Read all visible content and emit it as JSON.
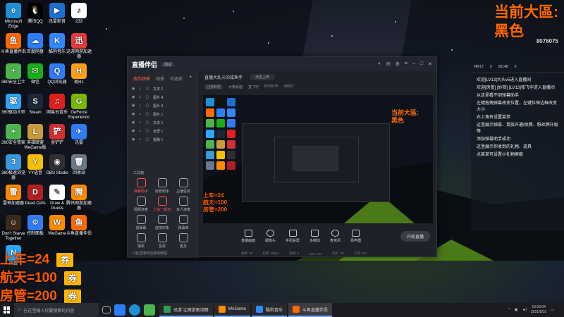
{
  "desktop_icons": [
    {
      "label": "Microsoft Edge",
      "color": "#1f8fd6",
      "glyph": "e"
    },
    {
      "label": "腾讯QQ",
      "color": "#000000",
      "glyph": "🐧"
    },
    {
      "label": "迅雷影音",
      "color": "#1e6fd0",
      "glyph": "▶"
    },
    {
      "label": "233",
      "color": "#ffffff",
      "glyph": "♪"
    },
    {
      "label": "斗鱼直播伴侣",
      "color": "#ff6a00",
      "glyph": "鱼"
    },
    {
      "label": "百度网盘",
      "color": "#2f7df6",
      "glyph": "☁"
    },
    {
      "label": "酷狗音乐",
      "color": "#2f88ff",
      "glyph": "K"
    },
    {
      "label": "迅游网游加速器",
      "color": "#e23b3b",
      "glyph": "迅"
    },
    {
      "label": "360安全卫士",
      "color": "#4bb44b",
      "glyph": "+"
    },
    {
      "label": "微信",
      "color": "#1aad19",
      "glyph": "✉"
    },
    {
      "label": "QQ浏览器",
      "color": "#2f7df6",
      "glyph": "Q"
    },
    {
      "label": "斑H1",
      "color": "#ff9f1a",
      "glyph": "H"
    },
    {
      "label": "360驱动大师",
      "color": "#2aa6ff",
      "glyph": "驱"
    },
    {
      "label": "Steam",
      "color": "#1b2838",
      "glyph": "S"
    },
    {
      "label": "网易云音乐",
      "color": "#e02020",
      "glyph": "♫"
    },
    {
      "label": "GeForce Experience",
      "color": "#76b900",
      "glyph": "G"
    },
    {
      "label": "360安全管家",
      "color": "#4bb44b",
      "glyph": "+"
    },
    {
      "label": "英雄联盟WeGame版",
      "color": "#c89b3c",
      "glyph": "L"
    },
    {
      "label": "金铲铲",
      "color": "#d23030",
      "glyph": "铲"
    },
    {
      "label": "迅雷",
      "color": "#2f7df6",
      "glyph": "✈"
    },
    {
      "label": "360极速浏览器",
      "color": "#3a96dd",
      "glyph": "3"
    },
    {
      "label": "YY语音",
      "color": "#f5c000",
      "glyph": "Y"
    },
    {
      "label": "OBS Studio",
      "color": "#302e31",
      "glyph": "◉"
    },
    {
      "label": "回收站",
      "color": "#6a7a8a",
      "glyph": "🗑"
    },
    {
      "label": "雷神加速器",
      "color": "#ff8a00",
      "glyph": "雷"
    },
    {
      "label": "Dead Cells",
      "color": "#b02020",
      "glyph": "D"
    },
    {
      "label": "Draw & Guess",
      "color": "#ffffff",
      "glyph": "✎"
    },
    {
      "label": "腾讯网游加速器",
      "color": "#ff8a00",
      "glyph": "腾"
    },
    {
      "label": "Don't Starve Together",
      "color": "#3a2a1a",
      "glyph": "☺"
    },
    {
      "label": "控制面板",
      "color": "#2f7df6",
      "glyph": "⚙"
    },
    {
      "label": "WeGame",
      "color": "#ff8a00",
      "glyph": "W"
    },
    {
      "label": "斗鱼直播伴侣",
      "color": "#ff6a00",
      "glyph": "鱼"
    },
    {
      "label": "网络",
      "color": "#2aa6ff",
      "glyph": "N"
    }
  ],
  "overlay_top_right": {
    "line1": "当前大區:",
    "line2": "黑色",
    "uid": "8076075"
  },
  "overlay_bottom_left": [
    {
      "text": "上车=24",
      "coupon": "券"
    },
    {
      "text": "航天=100",
      "coupon": "券"
    },
    {
      "text": "房管=200",
      "coupon": "券"
    }
  ],
  "chat": {
    "stats": [
      "#8017",
      "0",
      "20148",
      "0"
    ],
    "messages": [
      {
        "text": "欢迎[LV13]大头v5进入直播间",
        "cls": ""
      },
      {
        "text": "欢迎[房管] [妙荷] [LV13]夜飞宇进入直播间",
        "cls": "hl"
      },
      {
        "text": "从这里看不到弹幕助手",
        "cls": ""
      },
      {
        "text": "左键拖拽弹幕改变位置，左键拉伸边框改变大小",
        "cls": ""
      },
      {
        "text": "右上角有设置菜单",
        "cls": ""
      },
      {
        "text": "这里展示弹幕、贵族开通/续费、粉丝牌升级等",
        "cls": ""
      },
      {
        "text": "添加弹幕助手成功",
        "cls": ""
      },
      {
        "text": "这里展示你收到的礼物、道具",
        "cls": ""
      },
      {
        "text": "点菜单可设置小礼物屏蔽",
        "cls": ""
      }
    ]
  },
  "app": {
    "logo": "直播伴侣",
    "version": "测试",
    "tabs": [
      "我的场景",
      "场景",
      "可选项"
    ],
    "sources": [
      "文本 2",
      "图片 4",
      "图片 3",
      "图片 1",
      "文本 1",
      "全屏 1",
      "摄像 1"
    ],
    "tools_title": "工具箱",
    "tools": [
      {
        "label": "弹幕助手",
        "red": true
      },
      {
        "label": "房管助手",
        "red": false
      },
      {
        "label": "主播任务",
        "red": false
      },
      {
        "label": "视频连麦",
        "red": false
      },
      {
        "label": "上车一起玩",
        "red": true
      },
      {
        "label": "多人连麦",
        "red": false
      },
      {
        "label": "送弹幕",
        "red": false
      },
      {
        "label": "虚拟形象",
        "red": false
      },
      {
        "label": "弹幕库",
        "red": false
      },
      {
        "label": "抽奖",
        "red": false
      },
      {
        "label": "投票",
        "red": false
      },
      {
        "label": "更多",
        "red": false
      }
    ],
    "left_footer": "斗鱼直播伴侣使用教程",
    "room_title": "直播大乱斗的咸鱼手",
    "room_edit": "点击上传",
    "room_meta": [
      "回放数据",
      "大咖桌面",
      "直飞宇",
      "8076075",
      "#8937"
    ],
    "controls": [
      "直播画面",
      "摄像头",
      "手机投屏",
      "多媒体",
      "麦克风",
      "扬声器"
    ],
    "go_live": "开始直播",
    "status": [
      "帧率: 60",
      "码率: 0kbps",
      "丢帧: 0",
      "CPU: 0%",
      "内存: 0%",
      "内存: 0%"
    ],
    "preview_overlay": {
      "line1": "当前大區:",
      "line2": "黑色"
    }
  },
  "taskbar": {
    "search_placeholder": "在这里输入你要搜索的内容",
    "tasks": [
      {
        "label": "迅游 让网游更流畅",
        "color": "#2f9f4f",
        "active": false
      },
      {
        "label": "WeGame",
        "color": "#ff8a00",
        "active": false
      },
      {
        "label": "酷狗音乐",
        "color": "#2f88ff",
        "active": false
      },
      {
        "label": "斗鱼直播伴侣",
        "color": "#ff6a00",
        "active": true
      }
    ],
    "time": "19:03:04",
    "date": "2021/8/31"
  }
}
